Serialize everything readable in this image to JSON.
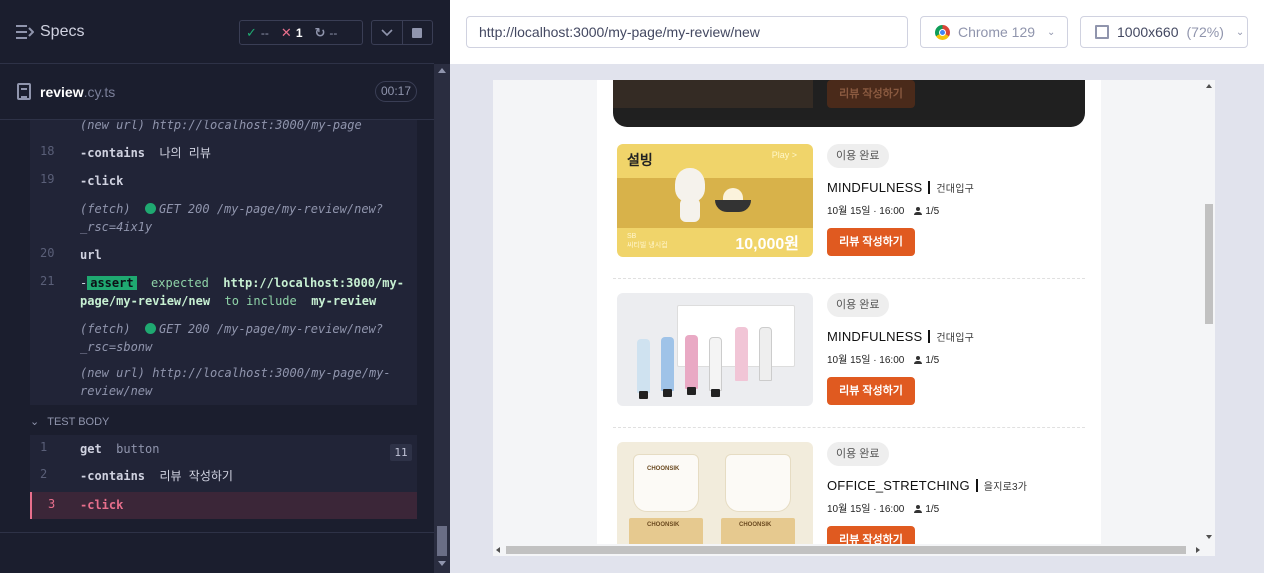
{
  "runner": {
    "specs_label": "Specs",
    "stats": {
      "passed": "--",
      "failed": "1",
      "pending": "--"
    },
    "spec": {
      "name": "review",
      "ext": ".cy.ts",
      "duration": "00:17"
    },
    "log": [
      {
        "line": "",
        "text": "(new url)  http://localhost:3000/my-page"
      },
      {
        "line": "18",
        "cmd": "-contains",
        "arg": "나의 리뷰"
      },
      {
        "line": "19",
        "cmd": "-click"
      },
      {
        "line": "",
        "text1": "(fetch)",
        "text2": "GET 200 /my-page/my-review/new?",
        "text3": "_rsc=4ix1y"
      },
      {
        "line": "20",
        "cmd": "url"
      },
      {
        "line": "21",
        "assert": "assert",
        "t1": "expected",
        "t2": "http://localhost:3000/my-",
        "t3": "page/my-review/new",
        "t4": "to include",
        "t5": "my-review"
      },
      {
        "line": "",
        "text1": "(fetch)",
        "text2": "GET 200 /my-page/my-review/new?",
        "text3": "_rsc=sbonw"
      },
      {
        "line": "",
        "text": "(new url)  http://localhost:3000/my-page/my-",
        "text_b": "review/new"
      }
    ],
    "test_body_label": "TEST BODY",
    "body": [
      {
        "line": "1",
        "cmd": "get",
        "arg": "button",
        "badge": "11"
      },
      {
        "line": "2",
        "cmd": "-contains",
        "arg": "리뷰 작성하기"
      },
      {
        "line": "3",
        "cmd": "-click"
      }
    ]
  },
  "browser": {
    "url": "http://localhost:3000/my-page/my-review/new",
    "browser_name": "Chrome 129",
    "viewport": "1000x660",
    "scale": "(72%)"
  },
  "app": {
    "top_button": "리뷰 작성하기",
    "items": [
      {
        "status": "이용 완료",
        "program": "MINDFULNESS",
        "location": "건대입구",
        "datetime": "10월 15일 · 16:00",
        "people": "1/5",
        "button": "리뷰 작성하기",
        "thumb": {
          "brand": "설빙",
          "play": "Play >",
          "small1": "SB",
          "small2": "씨티빌 냉시컵",
          "price": "10,000원"
        }
      },
      {
        "status": "이용 완료",
        "program": "MINDFULNESS",
        "location": "건대입구",
        "datetime": "10월 15일 · 16:00",
        "people": "1/5",
        "button": "리뷰 작성하기"
      },
      {
        "status": "이용 완료",
        "program": "OFFICE_STRETCHING",
        "location": "을지로3가",
        "datetime": "10월 15일 · 16:00",
        "people": "1/5",
        "button": "리뷰 작성하기",
        "thumb": {
          "label": "CHOONSIK"
        }
      }
    ]
  },
  "colors": {
    "accent": "#e05a20",
    "pass": "#1fa971",
    "fail": "#e86f8c",
    "runner_bg": "#1b1e2e"
  },
  "icons": [
    "specs-icon",
    "check-icon",
    "x-icon",
    "pending-icon",
    "chevron-down-icon",
    "stop-icon",
    "document-icon",
    "chrome-icon",
    "viewport-icon",
    "person-icon"
  ]
}
